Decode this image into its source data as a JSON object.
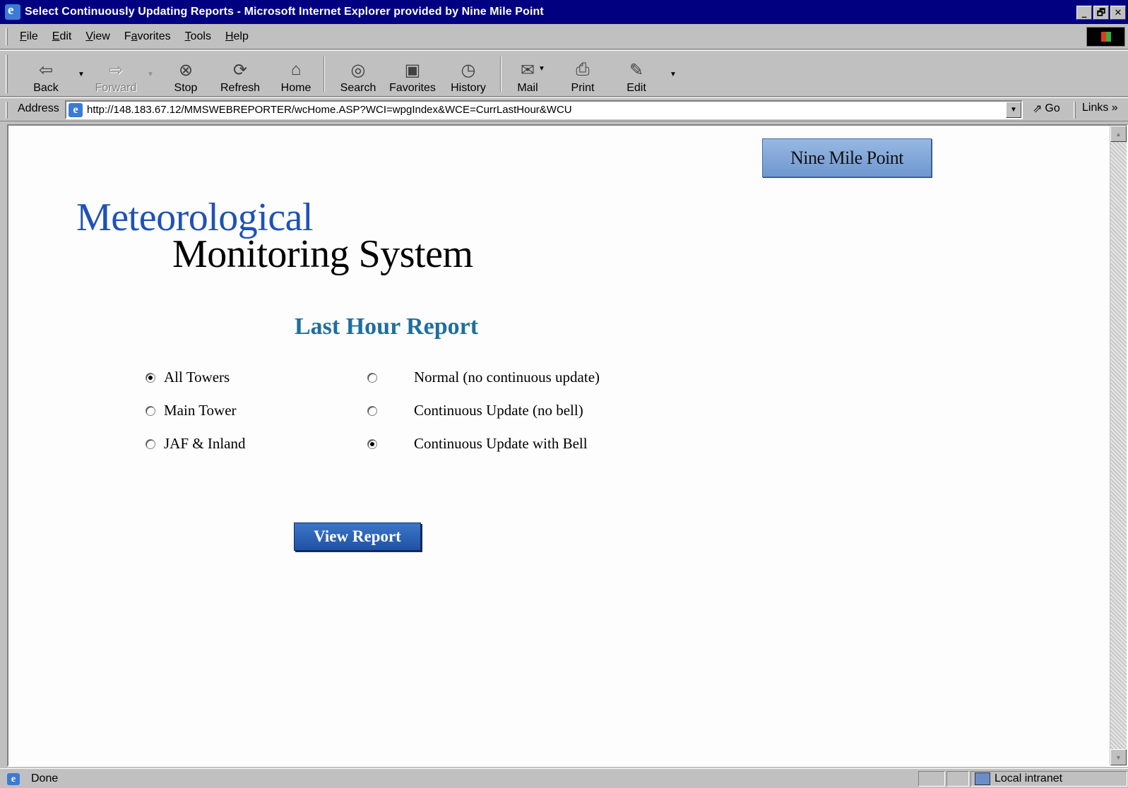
{
  "window": {
    "title": "Select Continuously Updating Reports - Microsoft Internet Explorer provided by Nine Mile Point",
    "minimize": "_",
    "maximize": "🗗",
    "close": "✕"
  },
  "menu": {
    "file": {
      "accel": "F",
      "rest": "ile"
    },
    "edit": {
      "accel": "E",
      "rest": "dit"
    },
    "view": {
      "accel": "V",
      "rest": "iew"
    },
    "favorites": {
      "pre": "F",
      "accel": "a",
      "rest": "vorites"
    },
    "tools": {
      "accel": "T",
      "rest": "ools"
    },
    "help": {
      "accel": "H",
      "rest": "elp"
    }
  },
  "toolbar": {
    "back": "Back",
    "forward": "Forward",
    "stop": "Stop",
    "refresh": "Refresh",
    "home": "Home",
    "search": "Search",
    "favorites": "Favorites",
    "history": "History",
    "mail": "Mail",
    "print": "Print",
    "edit": "Edit"
  },
  "address": {
    "label": "Address",
    "url": "http://148.183.67.12/MMSWEBREPORTER/wcHome.ASP?WCI=wpgIndex&WCE=CurrLastHour&WCU",
    "go": "Go",
    "links": "Links »"
  },
  "page": {
    "site_button": "Nine Mile Point",
    "brand_line1": "Meteorological",
    "brand_line2": "Monitoring System",
    "report_title": "Last Hour Report",
    "towers": [
      {
        "label": "All Towers",
        "selected": true
      },
      {
        "label": "Main Tower",
        "selected": false
      },
      {
        "label": "JAF & Inland",
        "selected": false
      }
    ],
    "modes": [
      {
        "label": "Normal (no continuous update)",
        "selected": false
      },
      {
        "label": "Continuous Update (no bell)",
        "selected": false
      },
      {
        "label": "Continuous Update with Bell",
        "selected": true
      }
    ],
    "view_button": "View Report"
  },
  "status": {
    "text": "Done",
    "zone": "Local intranet"
  },
  "colors": {
    "title_bar": "#000080",
    "brand_blue": "#1f52b5",
    "report_title": "#1f6e9e",
    "view_button": "#1f52a5"
  }
}
